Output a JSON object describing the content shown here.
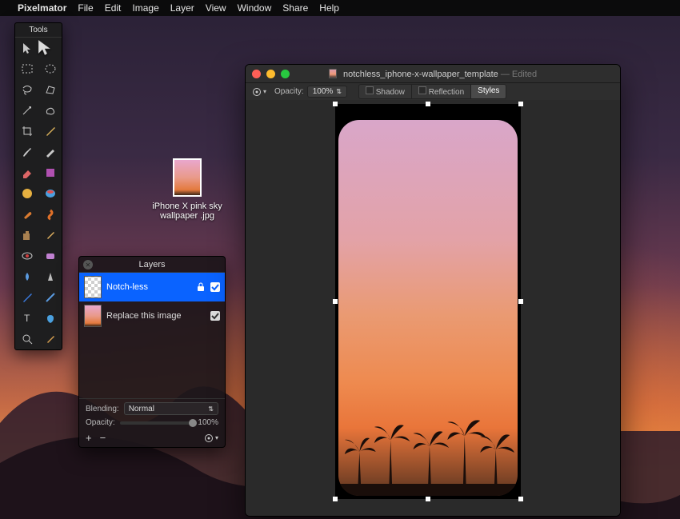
{
  "menubar": {
    "app": "Pixelmator",
    "items": [
      "File",
      "Edit",
      "Image",
      "Layer",
      "View",
      "Window",
      "Share",
      "Help"
    ]
  },
  "tools_panel": {
    "title": "Tools"
  },
  "desktop_file": {
    "name_line1": "iPhone X pink sky",
    "name_line2": "wallpaper .jpg"
  },
  "layers_panel": {
    "title": "Layers",
    "rows": [
      {
        "name": "Notch-less",
        "selected": true,
        "locked": true,
        "visible": true,
        "thumb": "checker"
      },
      {
        "name": "Replace this image",
        "selected": false,
        "locked": false,
        "visible": true,
        "thumb": "image"
      }
    ],
    "blending_label": "Blending:",
    "blending_value": "Normal",
    "opacity_label": "Opacity:",
    "opacity_value": "100%"
  },
  "document": {
    "title": "notchless_iphone-x-wallpaper_template",
    "edited_suffix": "— Edited",
    "toolbar": {
      "opacity_label": "Opacity:",
      "opacity_value": "100%",
      "shadow_label": "Shadow",
      "reflection_label": "Reflection",
      "styles_label": "Styles"
    }
  }
}
